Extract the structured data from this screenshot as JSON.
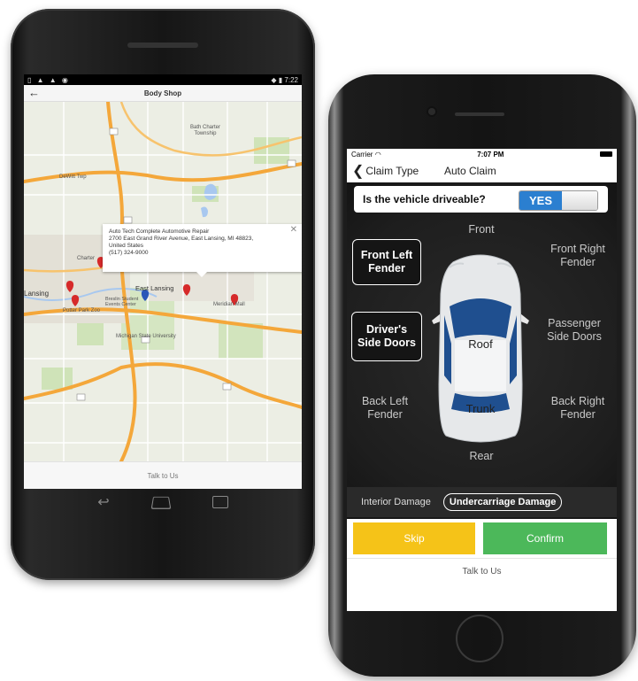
{
  "android": {
    "status_time": "7:22",
    "title": "Body Shop",
    "map_labels": [
      "Bath Charter Township",
      "DeWitt Twp",
      "East Lansing",
      "Lansing",
      "Charter",
      "Meridian Mall",
      "Potter Park Zoo",
      "Michigan State University",
      "Breslin Student Events Center"
    ],
    "popup": {
      "name": "Auto Tech Complete Automotive Repair",
      "address": "2700 East Grand River Avenue, East Lansing, MI 48823, United States",
      "phone": "(517) 324-9000"
    },
    "bottom": "Talk to Us"
  },
  "iphone": {
    "carrier": "Carrier",
    "time": "7:07 PM",
    "back_label": "Claim Type",
    "title": "Auto Claim",
    "question": "Is the vehicle driveable?",
    "toggle_value": "YES",
    "zones": {
      "front": "Front",
      "front_left": "Front Left Fender",
      "front_right": "Front Right Fender",
      "driver_side": "Driver's Side Doors",
      "passenger_side": "Passenger Side Doors",
      "back_left": "Back Left Fender",
      "back_right": "Back Right Fender",
      "rear": "Rear",
      "roof": "Roof",
      "trunk": "Trunk"
    },
    "interior": "Interior Damage",
    "undercarriage": "Undercarriage Damage",
    "skip": "Skip",
    "confirm": "Confirm",
    "talk": "Talk to Us"
  },
  "colors": {
    "toggle_on": "#2b7fd0",
    "skip": "#f5c318",
    "confirm": "#4cb85a",
    "pin": "#d62a2a",
    "pin_selected": "#2a56b8",
    "highway": "#f4a73a"
  }
}
